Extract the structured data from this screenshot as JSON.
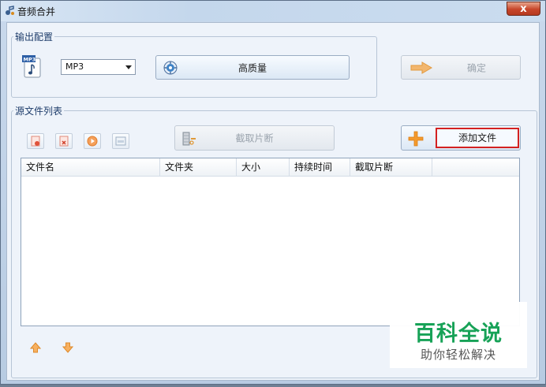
{
  "window": {
    "title": "音频合并",
    "close_label": "x"
  },
  "output_config": {
    "legend": "输出配置",
    "format_value": "MP3",
    "quality_button": "高质量",
    "confirm_button": "确定"
  },
  "source_files": {
    "legend": "源文件列表",
    "cut_button": "截取片断",
    "add_file_button": "添加文件",
    "columns": [
      "文件名",
      "文件夹",
      "大小",
      "持续时间",
      "截取片断"
    ],
    "rows": []
  },
  "watermark": {
    "main": "百科全说",
    "sub": "助你轻松解决"
  },
  "colors": {
    "accent_red": "#d32121",
    "watermark_green": "#17a257",
    "orange": "#f39a2e"
  }
}
